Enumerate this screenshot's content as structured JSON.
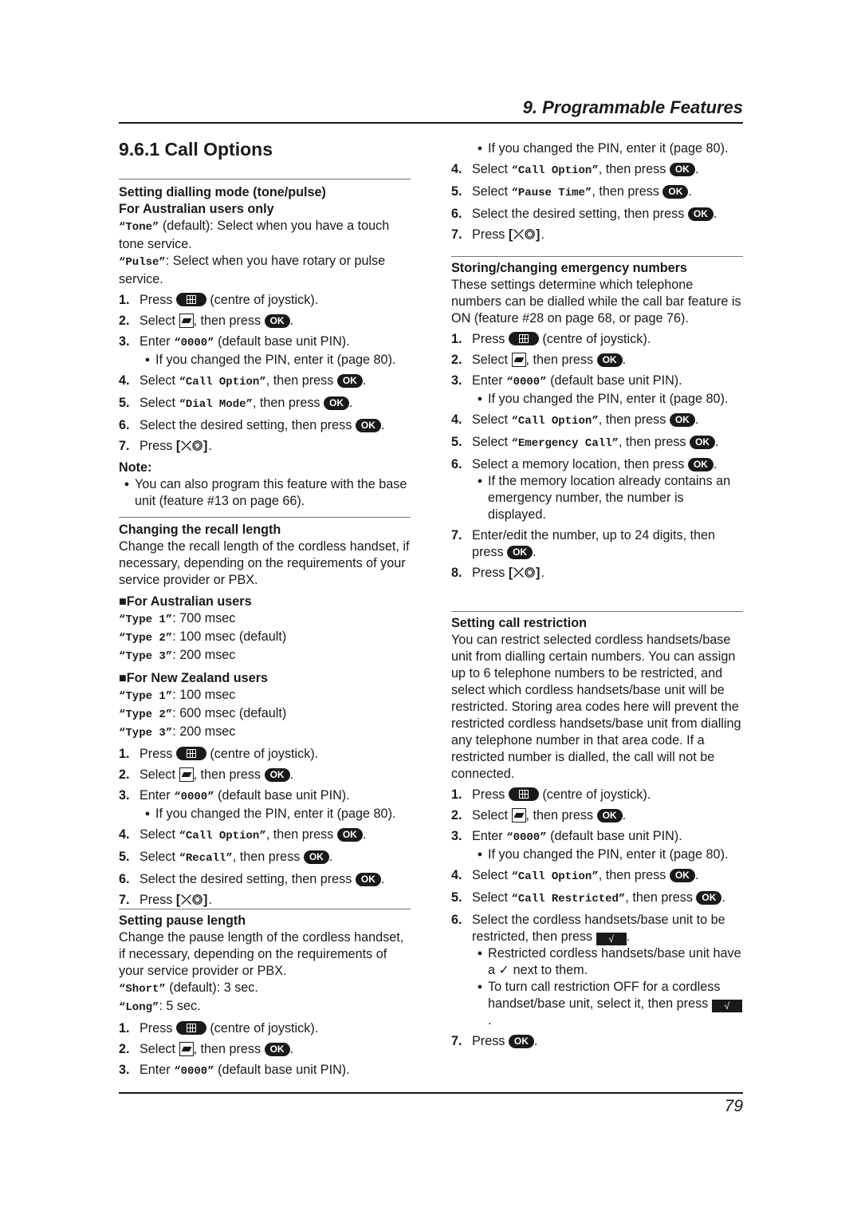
{
  "header": {
    "chapter_title": "9. Programmable Features"
  },
  "section_title": "9.6.1 Call Options",
  "footer": {
    "page_number": "79"
  },
  "icons": {
    "ok": "OK",
    "check": "√",
    "off_key": "[⤫◎]",
    "tick": "✓"
  },
  "dialling_mode": {
    "heading": "Setting dialling mode (tone/pulse)",
    "subheading": "For Australian users only",
    "options": [
      {
        "code": "“Tone”",
        "desc": " (default): Select when you have a touch tone service."
      },
      {
        "code": "“Pulse”",
        "desc": ": Select when you have rotary or pulse service."
      }
    ],
    "steps": [
      {
        "num": "1.",
        "pre": "Press ",
        "post": " (centre of joystick)."
      },
      {
        "num": "2.",
        "pre": "Select ",
        "mid": ", then press ",
        "post": "."
      },
      {
        "num": "3.",
        "pre": "Enter ",
        "code": "“0000”",
        "post": " (default base unit PIN)."
      },
      {
        "num": "4.",
        "pre": "Select ",
        "code": "“Call Option”",
        "mid": ", then press ",
        "post": "."
      },
      {
        "num": "5.",
        "pre": "Select ",
        "code": "“Dial Mode”",
        "mid": ", then press ",
        "post": "."
      },
      {
        "num": "6.",
        "pre": "Select the desired setting, then press ",
        "post": "."
      },
      {
        "num": "7.",
        "pre": "Press ",
        "post": "."
      }
    ],
    "step3_bullet": "If you changed the PIN, enter it (page 80).",
    "note_label": "Note:",
    "note": "You can also program this feature with the base unit (feature #13 on page 66)."
  },
  "recall_length": {
    "heading": "Changing the recall length",
    "intro": "Change the recall length of the cordless handset, if necessary, depending on the requirements of your service provider or PBX.",
    "australia": {
      "label": "■For Australian users",
      "options": [
        {
          "code": "“Type 1”",
          "desc": ": 700 msec"
        },
        {
          "code": "“Type 2”",
          "desc": ": 100 msec (default)"
        },
        {
          "code": "“Type 3”",
          "desc": ": 200 msec"
        }
      ]
    },
    "new_zealand": {
      "label": "■For New Zealand users",
      "options": [
        {
          "code": "“Type 1”",
          "desc": ": 100 msec"
        },
        {
          "code": "“Type 2”",
          "desc": ": 600 msec (default)"
        },
        {
          "code": "“Type 3”",
          "desc": ": 200 msec"
        }
      ]
    },
    "steps": [
      {
        "num": "1.",
        "pre": "Press ",
        "post": " (centre of joystick)."
      },
      {
        "num": "2.",
        "pre": "Select ",
        "mid": ", then press ",
        "post": "."
      },
      {
        "num": "3.",
        "pre": "Enter ",
        "code": "“0000”",
        "post": " (default base unit PIN)."
      },
      {
        "num": "4.",
        "pre": "Select ",
        "code": "“Call Option”",
        "mid": ", then press ",
        "post": "."
      },
      {
        "num": "5.",
        "pre": "Select ",
        "code": "“Recall”",
        "mid": ", then press ",
        "post": "."
      },
      {
        "num": "6.",
        "pre": "Select the desired setting, then press ",
        "post": "."
      },
      {
        "num": "7.",
        "pre": "Press ",
        "post": "."
      }
    ],
    "step3_bullet": "If you changed the PIN, enter it (page 80)."
  },
  "pause_length": {
    "heading": "Setting pause length",
    "intro": "Change the pause length of the cordless handset, if necessary, depending on the requirements of your service provider or PBX.",
    "options": [
      {
        "code": "“Short”",
        "desc": " (default): 3 sec."
      },
      {
        "code": "“Long”",
        "desc": ": 5 sec."
      }
    ],
    "steps": [
      {
        "num": "1.",
        "pre": "Press ",
        "post": " (centre of joystick)."
      },
      {
        "num": "2.",
        "pre": "Select ",
        "mid": ", then press ",
        "post": "."
      },
      {
        "num": "3.",
        "pre": "Enter ",
        "code": "“0000”",
        "post": " (default base unit PIN)."
      },
      {
        "num": "4.",
        "pre": "Select ",
        "code": "“Call Option”",
        "mid": ", then press ",
        "post": "."
      },
      {
        "num": "5.",
        "pre": "Select ",
        "code": "“Pause Time”",
        "mid": ", then press ",
        "post": "."
      },
      {
        "num": "6.",
        "pre": "Select the desired setting, then press ",
        "post": "."
      },
      {
        "num": "7.",
        "pre": "Press ",
        "post": "."
      }
    ],
    "step3_bullet": "If you changed the PIN, enter it (page 80)."
  },
  "emergency": {
    "heading": "Storing/changing emergency numbers",
    "intro": "These settings determine which telephone numbers can be dialled while the call bar feature is ON (feature #28 on page 68, or page 76).",
    "steps": [
      {
        "num": "1.",
        "pre": "Press ",
        "post": " (centre of joystick)."
      },
      {
        "num": "2.",
        "pre": "Select ",
        "mid": ", then press ",
        "post": "."
      },
      {
        "num": "3.",
        "pre": "Enter ",
        "code": "“0000”",
        "post": " (default base unit PIN)."
      },
      {
        "num": "4.",
        "pre": "Select ",
        "code": "“Call Option”",
        "mid": ", then press ",
        "post": "."
      },
      {
        "num": "5.",
        "pre": "Select ",
        "code": "“Emergency Call”",
        "mid": ", then press ",
        "post": "."
      },
      {
        "num": "6.",
        "pre": "Select a memory location, then press ",
        "post": "."
      },
      {
        "num": "7.",
        "pre": "Enter/edit the number, up to 24 digits, then press ",
        "post": "."
      },
      {
        "num": "8.",
        "pre": "Press ",
        "post": "."
      }
    ],
    "step3_bullet": "If you changed the PIN, enter it (page 80).",
    "step6_bullet": "If the memory location already contains an emergency number, the number is displayed."
  },
  "restriction": {
    "heading": "Setting call restriction",
    "intro": "You can restrict selected cordless handsets/base unit from dialling certain numbers. You can assign up to 6 telephone numbers to be restricted, and select which cordless handsets/base unit will be restricted. Storing area codes here will prevent the restricted cordless handsets/base unit from dialling any telephone number in that area code. If a restricted number is dialled, the call will not be connected.",
    "steps": [
      {
        "num": "1.",
        "pre": "Press ",
        "post": " (centre of joystick)."
      },
      {
        "num": "2.",
        "pre": "Select ",
        "mid": ", then press ",
        "post": "."
      },
      {
        "num": "3.",
        "pre": "Enter ",
        "code": "“0000”",
        "post": " (default base unit PIN)."
      },
      {
        "num": "4.",
        "pre": "Select ",
        "code": "“Call Option”",
        "mid": ", then press ",
        "post": "."
      },
      {
        "num": "5.",
        "pre": "Select ",
        "code": "“Call Restricted”",
        "mid": ", then press ",
        "post": "."
      },
      {
        "num": "6.",
        "pre": "Select the cordless handsets/base unit to be restricted, then press ",
        "post": "."
      },
      {
        "num": "7.",
        "pre": "Press ",
        "post": "."
      }
    ],
    "step3_bullet": "If you changed the PIN, enter it (page 80).",
    "step6_bullet_a_pre": "Restricted cordless handsets/base unit have a ",
    "step6_bullet_a_post": " next to them.",
    "step6_bullet_b": "To turn call restriction OFF for a cordless handset/base unit, select it, then press "
  }
}
